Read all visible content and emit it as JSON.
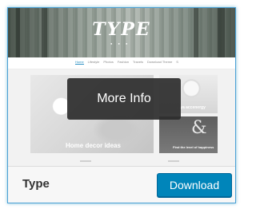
{
  "theme": {
    "name": "Type",
    "download_label": "Download",
    "overlay_label": "More Info"
  },
  "preview": {
    "hero_title": "TYPE",
    "nav_items": [
      "Home",
      "Lifestyle",
      "Photos",
      "Fashion",
      "Travels",
      "Download Theme",
      "S"
    ],
    "tiles": [
      {
        "caption": "Home decor ideas"
      },
      {
        "caption": "...ya accenergy"
      },
      {
        "caption": "Find the level of happiness"
      }
    ]
  },
  "colors": {
    "accent": "#0085ba",
    "selection_border": "#4aa0d5",
    "overlay_bg": "#2d2d2d"
  }
}
